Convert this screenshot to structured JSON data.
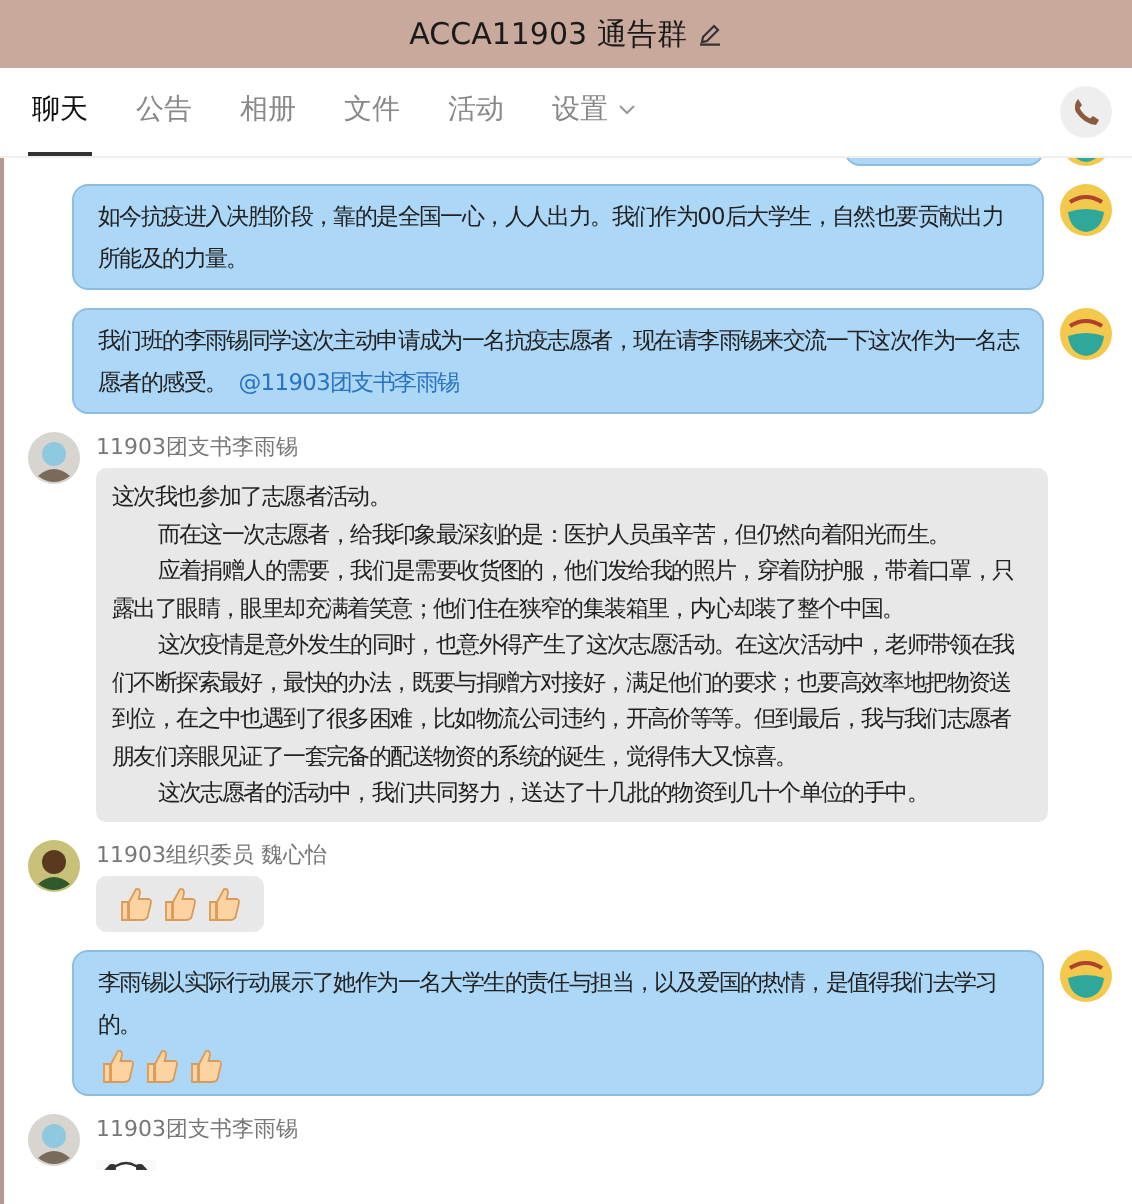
{
  "window": {
    "title": "ACCA11903 通告群"
  },
  "tabs": [
    {
      "label": "聊天",
      "selected": true
    },
    {
      "label": "公告",
      "selected": false
    },
    {
      "label": "相册",
      "selected": false
    },
    {
      "label": "文件",
      "selected": false
    },
    {
      "label": "活动",
      "selected": false
    },
    {
      "label": "设置",
      "selected": false,
      "dropdown": true
    }
  ],
  "messages": [
    {
      "outgoing": true,
      "kind": "clipped"
    },
    {
      "outgoing": true,
      "kind": "text",
      "paragraphs": [
        {
          "text": "如今抗疫进入决胜阶段，靠的是全国一心，人人出力。我们作为00后大学生，自然也要贡献出力所能及的力量。",
          "indent": false
        }
      ]
    },
    {
      "outgoing": true,
      "kind": "text",
      "paragraphs": [
        {
          "text": "我们班的李雨锡同学这次主动申请成为一名抗疫志愿者，现在请李雨锡来交流一下这次作为一名志愿者的感受。",
          "indent": false
        }
      ],
      "mention": "@11903团支书李雨锡"
    },
    {
      "outgoing": false,
      "kind": "text",
      "sender": "11903团支书李雨锡",
      "paragraphs": [
        {
          "text": "这次我也参加了志愿者活动。",
          "indent": false
        },
        {
          "text": "而在这一次志愿者，给我印象最深刻的是：医护人员虽辛苦，但仍然向着阳光而生。",
          "indent": true
        },
        {
          "text": "应着捐赠人的需要，我们是需要收货图的，他们发给我的照片，穿着防护服，带着口罩，只露出了眼睛，眼里却充满着笑意；他们住在狭窄的集装箱里，内心却装了整个中国。",
          "indent": true
        },
        {
          "text": "这次疫情是意外发生的同时，也意外得产生了这次志愿活动。在这次活动中，老师带领在我们不断探索最好，最快的办法，既要与捐赠方对接好，满足他们的要求；也要高效率地把物资送到位，在之中也遇到了很多困难，比如物流公司违约，开高价等等。但到最后，我与我们志愿者朋友们亲眼见证了一套完备的配送物资的系统的诞生，觉得伟大又惊喜。",
          "indent": true
        },
        {
          "text": "这次志愿者的活动中，我们共同努力，送达了十几批的物资到几十个单位的手中。",
          "indent": true
        }
      ]
    },
    {
      "outgoing": false,
      "kind": "emoji",
      "sender": "11903组织委员  魏心怡",
      "emojis": [
        {
          "kind": "thumbs-up"
        },
        {
          "kind": "thumbs-up"
        },
        {
          "kind": "thumbs-up"
        }
      ]
    },
    {
      "outgoing": true,
      "kind": "text",
      "paragraphs": [
        {
          "text": "李雨锡以实际行动展示了她作为一名大学生的责任与担当，以及爱国的热情，是值得我们去学习的。",
          "indent": false
        }
      ],
      "emojis": [
        {
          "kind": "thumbs-up"
        },
        {
          "kind": "thumbs-up"
        },
        {
          "kind": "thumbs-up"
        }
      ]
    },
    {
      "outgoing": false,
      "kind": "picture",
      "sender": "11903团支书李雨锡"
    }
  ]
}
